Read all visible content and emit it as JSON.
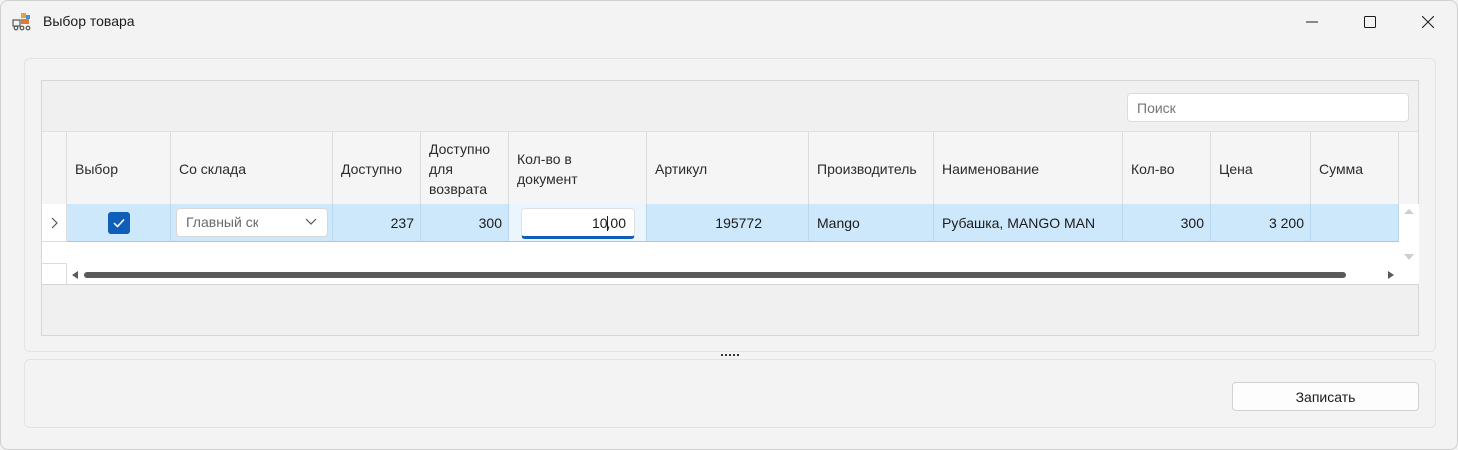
{
  "window": {
    "title": "Выбор товара",
    "icon": "app-warehouse-icon"
  },
  "search": {
    "placeholder": "Поиск"
  },
  "table": {
    "columns": [
      "Выбор",
      "Со склада",
      "Доступно",
      "Доступно для возврата",
      "Кол-во в документ",
      "Артикул",
      "Производитель",
      "Наименование",
      "Кол-во",
      "Цена",
      "Сумма"
    ],
    "rows": [
      {
        "selected": true,
        "warehouse": "Главный склад",
        "available": "237",
        "available_return": "300",
        "qty_doc": "10,00",
        "article": "195772",
        "manufacturer": "Mango",
        "name": "Рубашка, MANGO MAN",
        "qty": "300",
        "price": "3 200",
        "sum": ""
      }
    ]
  },
  "footer": {
    "save_label": "Записать"
  },
  "colors": {
    "accent": "#0f5fb8",
    "row_highlight": "#cde8fb"
  }
}
